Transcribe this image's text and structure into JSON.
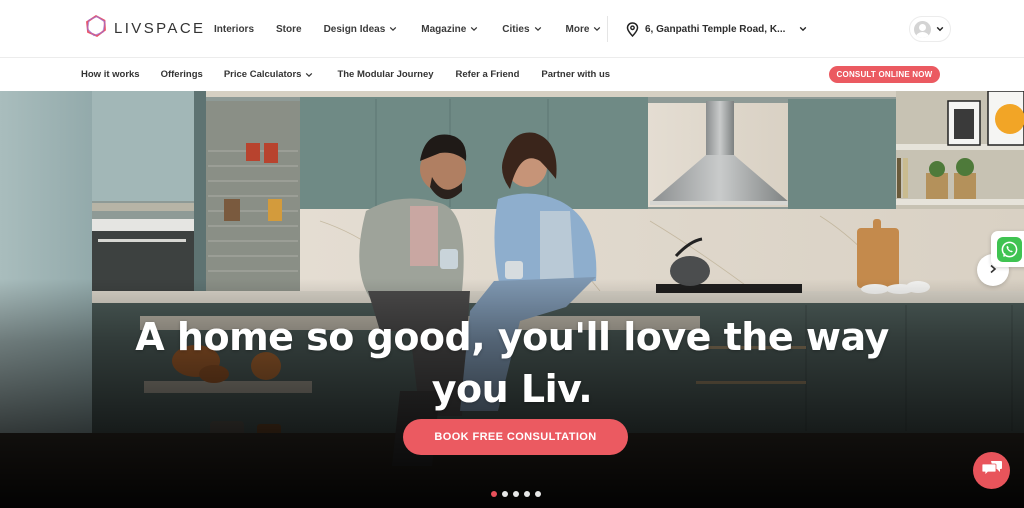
{
  "brand": {
    "name": "LIVSPACE",
    "accent_color": "#eb5a61"
  },
  "header": {
    "nav": [
      {
        "label": "Interiors",
        "has_dropdown": false
      },
      {
        "label": "Store",
        "has_dropdown": false
      },
      {
        "label": "Design Ideas",
        "has_dropdown": true
      },
      {
        "label": "Magazine",
        "has_dropdown": true
      },
      {
        "label": "Cities",
        "has_dropdown": true
      },
      {
        "label": "More",
        "has_dropdown": true
      }
    ],
    "location": {
      "icon": "map-pin-icon",
      "text": "6, Ganpathi Temple Road, K..."
    },
    "profile": {
      "icon": "user-avatar-icon"
    }
  },
  "sub_nav": {
    "items": [
      {
        "label": "How it works",
        "has_dropdown": false
      },
      {
        "label": "Offerings",
        "has_dropdown": false
      },
      {
        "label": "Price Calculators",
        "has_dropdown": true
      },
      {
        "label": "The Modular Journey",
        "has_dropdown": false
      },
      {
        "label": "Refer a Friend",
        "has_dropdown": false
      },
      {
        "label": "Partner with us",
        "has_dropdown": false
      }
    ],
    "cta_label": "CONSULT ONLINE NOW"
  },
  "hero": {
    "title_line1": "A home so good, you'll love the way",
    "title_line2": "you Liv.",
    "cta_label": "BOOK FREE CONSULTATION",
    "carousel": {
      "total_slides": 5,
      "active_index": 0
    },
    "next_icon": "chevron-right-icon"
  },
  "floating": {
    "whatsapp_icon": "whatsapp-icon",
    "chat_icon": "chat-bubbles-icon"
  }
}
